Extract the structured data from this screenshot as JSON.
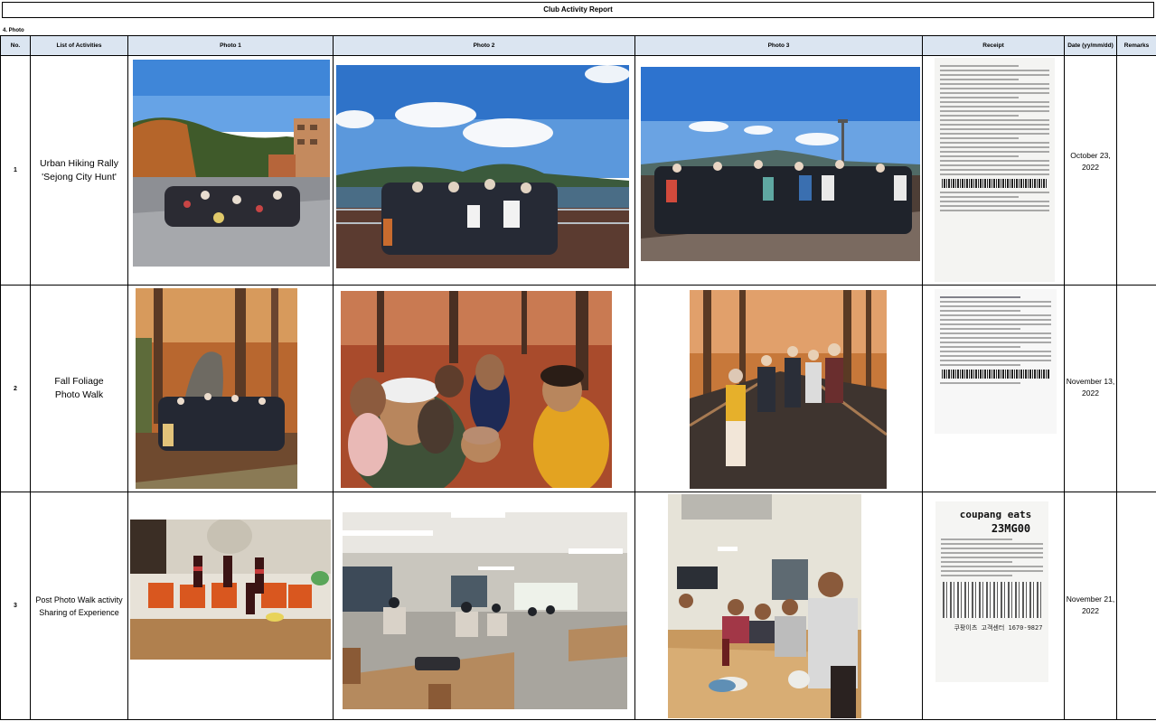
{
  "report": {
    "title": "Club Activity Report",
    "section": "4. Photo"
  },
  "columns": {
    "no": "No.",
    "activities": "List of Activities",
    "photo1": "Photo 1",
    "photo2": "Photo 2",
    "photo3": "Photo 3",
    "receipt": "Receipt",
    "date": "Date (yy/mm/dd)",
    "remarks": "Remarks"
  },
  "rows": [
    {
      "no": "1",
      "activity_line1": "Urban Hiking Rally",
      "activity_line2": "'Sejong City Hunt'",
      "date_line1": "October 23,",
      "date_line2": "2022",
      "remarks": ""
    },
    {
      "no": "2",
      "activity_line1": "Fall Foliage",
      "activity_line2": "Photo Walk",
      "date_line1": "November 13,",
      "date_line2": "2022",
      "remarks": ""
    },
    {
      "no": "3",
      "activity_line1": "Post Photo Walk activity",
      "activity_line2": "Sharing of Experience",
      "date_line1": "November 21,",
      "date_line2": "2022",
      "remarks": ""
    }
  ],
  "receipt3": {
    "brand": "coupang eats",
    "code": "23MG00",
    "footer": "쿠팡이츠 고객센터 1670-9827"
  }
}
